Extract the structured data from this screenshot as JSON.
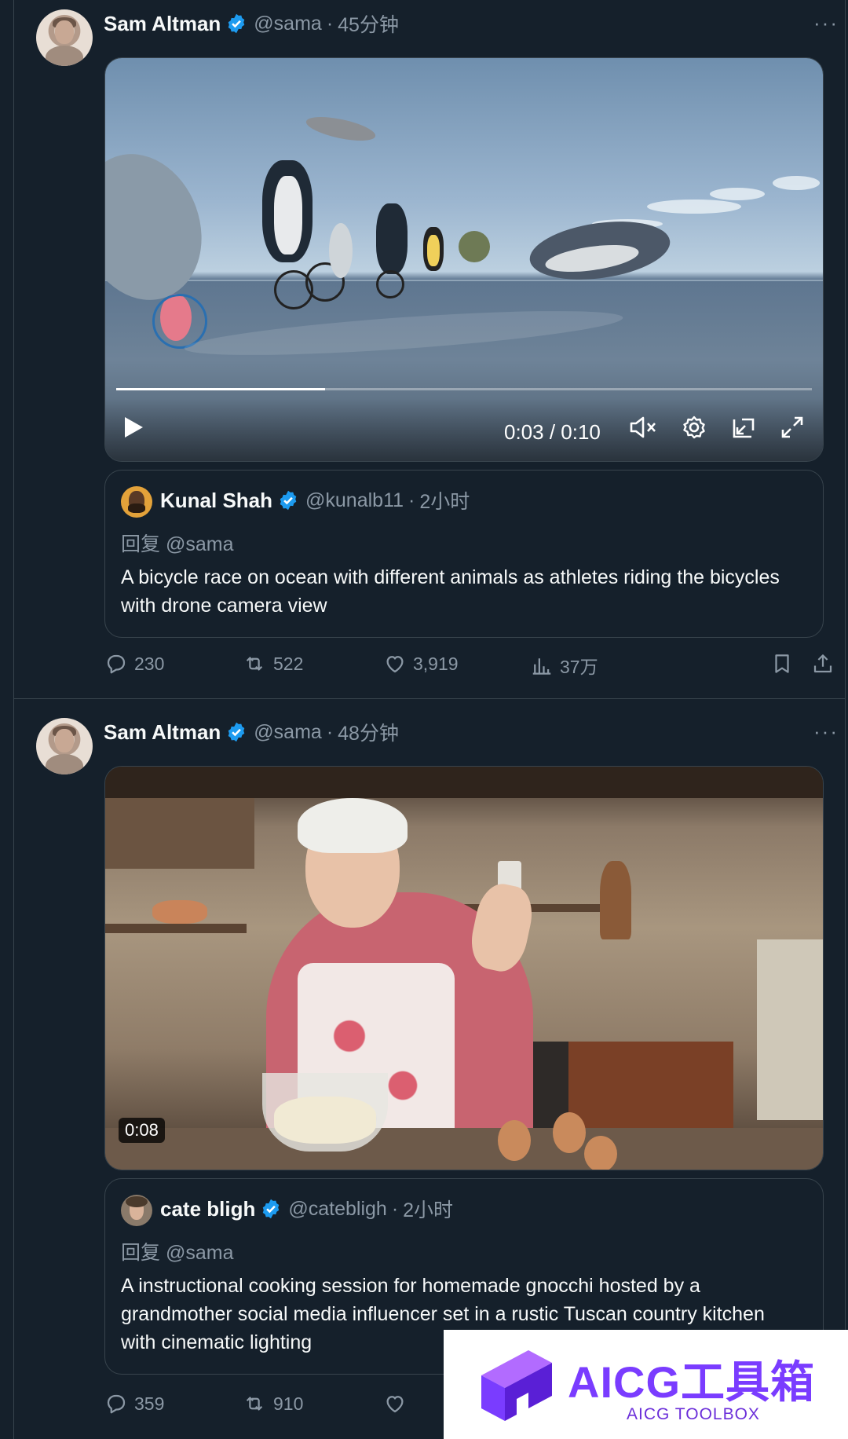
{
  "colors": {
    "background": "#15202b",
    "text": "#f7f9f9",
    "muted": "#8b98a5",
    "verified": "#1d9bf0",
    "watermark": "#7a3cff"
  },
  "tweets": [
    {
      "author": "Sam Altman",
      "handle": "@sama",
      "dot": "·",
      "time": "45分钟",
      "media": {
        "kind": "video",
        "timecode": "0:03 / 0:10",
        "progress_fraction": 0.3
      },
      "quote": {
        "author": "Kunal Shah",
        "handle": "@kunalb11",
        "time": "2小时",
        "reply_prefix": "回复",
        "reply_to": "@sama",
        "text": "A bicycle race on ocean with different animals as athletes riding the bicycles with drone camera view"
      },
      "actions": {
        "replies": "230",
        "reposts": "522",
        "likes": "3,919",
        "views": "37万"
      }
    },
    {
      "author": "Sam Altman",
      "handle": "@sama",
      "dot": "·",
      "time": "48分钟",
      "media": {
        "kind": "video",
        "duration": "0:08"
      },
      "quote": {
        "author": "cate bligh",
        "handle": "@catebligh",
        "time": "2小时",
        "reply_prefix": "回复",
        "reply_to": "@sama",
        "text": "A instructional cooking session for homemade gnocchi hosted by a grandmother social media influencer set in a rustic Tuscan country kitchen with cinematic lighting"
      },
      "actions": {
        "replies": "359",
        "reposts": "910"
      }
    }
  ],
  "watermark": {
    "title": "AICG工具箱",
    "subtitle": "AICG TOOLBOX"
  },
  "icons": [
    "more-icon",
    "verified-icon",
    "play-icon",
    "mute-icon",
    "settings-icon",
    "pip-icon",
    "fullscreen-icon",
    "reply-icon",
    "repost-icon",
    "like-icon",
    "views-icon",
    "bookmark-icon",
    "share-icon"
  ]
}
